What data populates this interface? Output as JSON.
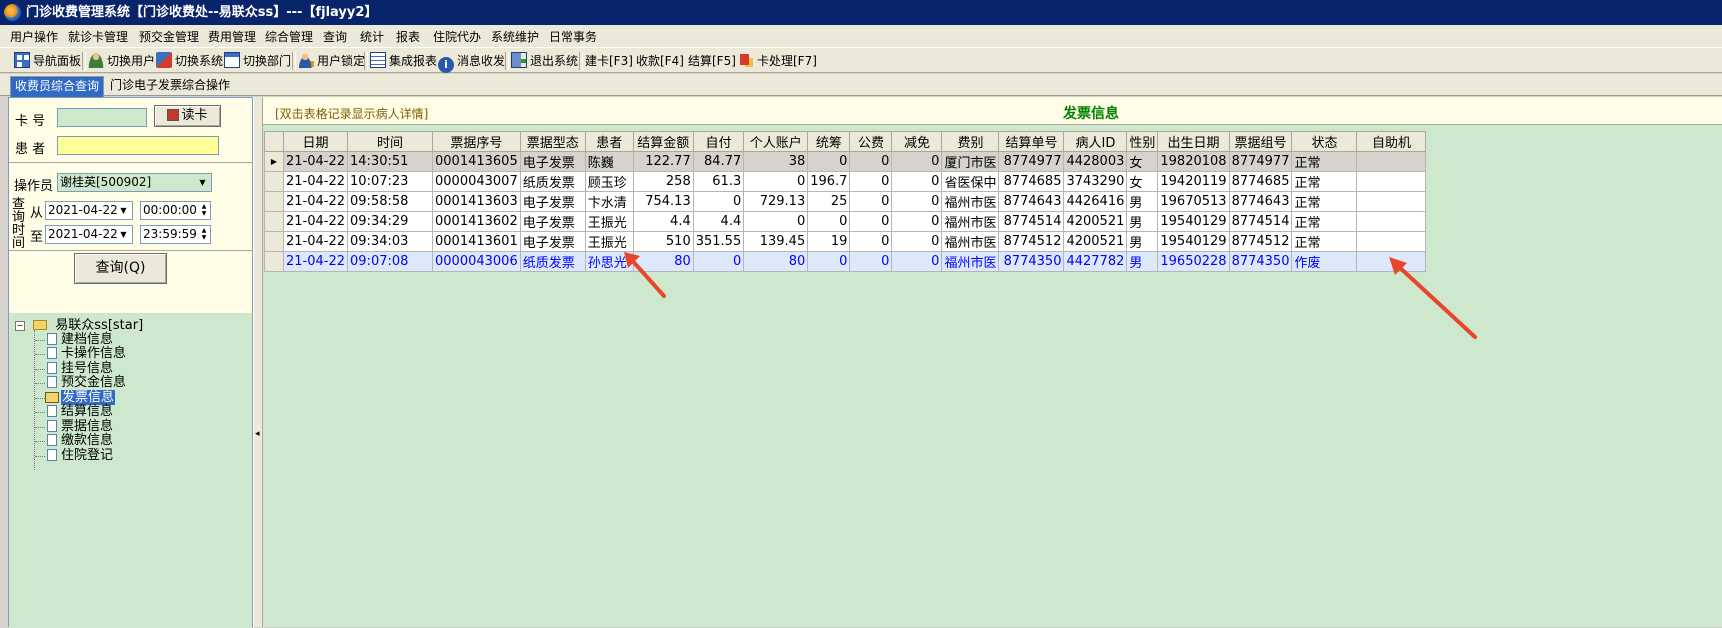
{
  "window": {
    "title": "门诊收费管理系统【门诊收费处--易联众ss】---【fjlayy2】"
  },
  "menubar": {
    "items": [
      "用户操作",
      "就诊卡管理",
      "预交金管理",
      "费用管理",
      "综合管理",
      "查询",
      "统计",
      "报表",
      "住院代办",
      "系统维护",
      "日常事务"
    ]
  },
  "toolbar": {
    "items": [
      "导航面板",
      "切换用户",
      "切换系统",
      "切换部门",
      "用户锁定",
      "集成报表",
      "消息收发",
      "退出系统",
      "建卡[F3]",
      "收款[F4]",
      "结算[F5]",
      "卡处理[F7]"
    ]
  },
  "tabs": [
    "收费员综合查询",
    "门诊电子发票综合操作"
  ],
  "query": {
    "card_label": "卡  号",
    "card_value": "",
    "read_card_label": "读卡",
    "patient_label": "患  者",
    "patient_value": "",
    "operator_label": "操作员",
    "operator_value": "谢桂英[500902]",
    "query_time_label_1": "查",
    "query_time_label_2": "询",
    "query_time_label_3": "时",
    "query_time_label_4": "间",
    "from_label": "从",
    "to_label": "至",
    "from_date": "2021-04-22",
    "from_time": "00:00:00",
    "to_date": "2021-04-22",
    "to_time": "23:59:59",
    "query_button": "查询(Q)"
  },
  "tree": {
    "root": "易联众ss[star]",
    "items": [
      "建档信息",
      "卡操作信息",
      "挂号信息",
      "预交金信息",
      "发票信息",
      "结算信息",
      "票据信息",
      "缴款信息",
      "住院登记"
    ],
    "selected_index": 4
  },
  "main": {
    "hint": "[双击表格记录显示病人详情]",
    "section_title": "发票信息",
    "columns": [
      "日期",
      "时间",
      "票据序号",
      "票据型态",
      "患者",
      "结算金额",
      "自付",
      "个人账户",
      "统筹",
      "公费",
      "减免",
      "费别",
      "结算单号",
      "病人ID",
      "性别",
      "出生日期",
      "票据组号",
      "状态",
      "自助机"
    ],
    "rows": [
      [
        "21-04-22",
        "14:30:51",
        "0001413605",
        "电子发票",
        "陈巍",
        "122.77",
        "84.77",
        "38",
        "0",
        "0",
        "0",
        "厦门市医",
        "8774977",
        "4428003",
        "女",
        "19820108",
        "8774977",
        "正常",
        ""
      ],
      [
        "21-04-22",
        "10:07:23",
        "0000043007",
        "纸质发票",
        "顾玉珍",
        "258",
        "61.3",
        "0",
        "196.7",
        "0",
        "0",
        "省医保中",
        "8774685",
        "3743290",
        "女",
        "19420119",
        "8774685",
        "正常",
        ""
      ],
      [
        "21-04-22",
        "09:58:58",
        "0001413603",
        "电子发票",
        "卞水清",
        "754.13",
        "0",
        "729.13",
        "25",
        "0",
        "0",
        "福州市医",
        "8774643",
        "4426416",
        "男",
        "19670513",
        "8774643",
        "正常",
        ""
      ],
      [
        "21-04-22",
        "09:34:29",
        "0001413602",
        "电子发票",
        "王振光",
        "4.4",
        "4.4",
        "0",
        "0",
        "0",
        "0",
        "福州市医",
        "8774514",
        "4200521",
        "男",
        "19540129",
        "8774514",
        "正常",
        ""
      ],
      [
        "21-04-22",
        "09:34:03",
        "0001413601",
        "电子发票",
        "王振光",
        "510",
        "351.55",
        "139.45",
        "19",
        "0",
        "0",
        "福州市医",
        "8774512",
        "4200521",
        "男",
        "19540129",
        "8774512",
        "正常",
        ""
      ],
      [
        "21-04-22",
        "09:07:08",
        "0000043006",
        "纸质发票",
        "孙思光",
        "80",
        "0",
        "80",
        "0",
        "0",
        "0",
        "福州市医",
        "8774350",
        "4427782",
        "男",
        "19650228",
        "8774350",
        "作废",
        ""
      ]
    ]
  },
  "colors": {
    "title_bar": "#08246b",
    "panel_green": "#cde8cd",
    "voided_text": "#0000ff",
    "annotation_arrow": "#e8452c"
  }
}
